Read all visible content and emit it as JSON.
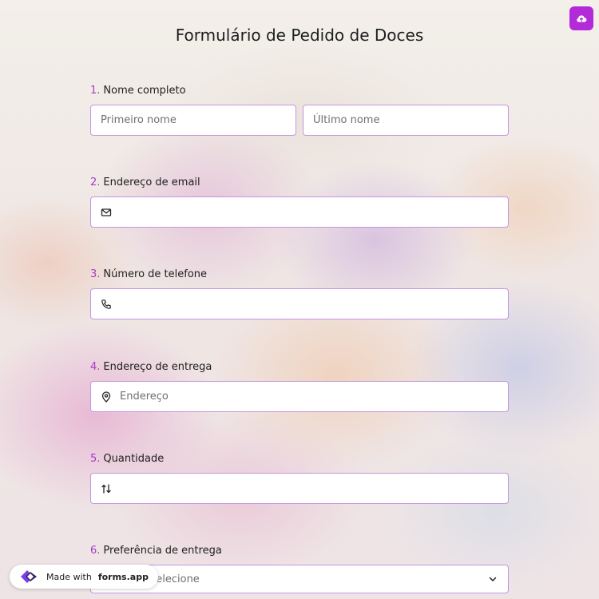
{
  "form": {
    "title": "Formulário de Pedido de Doces",
    "fields": [
      {
        "num": "1.",
        "label": "Nome completo",
        "first_placeholder": "Primeiro nome",
        "last_placeholder": "Último nome"
      },
      {
        "num": "2.",
        "label": "Endereço de email",
        "icon": "envelope-icon",
        "value": ""
      },
      {
        "num": "3.",
        "label": "Número de telefone",
        "icon": "phone-icon",
        "value": ""
      },
      {
        "num": "4.",
        "label": "Endereço de entrega",
        "icon": "location-pin-icon",
        "placeholder": "Endereço"
      },
      {
        "num": "5.",
        "label": "Quantidade",
        "icon": "sort-arrows-icon",
        "value": ""
      },
      {
        "num": "6.",
        "label": "Preferência de entrega",
        "select_text": "Por favor selecione",
        "icon": "chevron-down-icon"
      }
    ]
  },
  "toolbar": {
    "upload_icon": "cloud-upload-icon"
  },
  "badge": {
    "prefix": "Made with",
    "brand": "forms.app"
  },
  "colors": {
    "accent": "#b32ad9",
    "label_number": "#a43cc7",
    "input_border": "#c595e0"
  }
}
